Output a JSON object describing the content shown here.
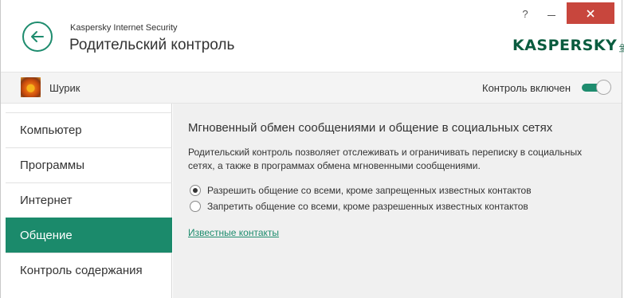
{
  "header": {
    "app_name": "Kaspersky Internet Security",
    "page_title": "Родительский контроль",
    "help": "?",
    "logo": "KASPERSKY",
    "logo_suffix": "lab"
  },
  "userbar": {
    "user_name": "Шурик",
    "control_label": "Контроль включен",
    "control_enabled": true
  },
  "sidebar": {
    "items": [
      {
        "label": "Компьютер",
        "active": false
      },
      {
        "label": "Программы",
        "active": false
      },
      {
        "label": "Интернет",
        "active": false
      },
      {
        "label": "Общение",
        "active": true
      },
      {
        "label": "Контроль содержания",
        "active": false
      }
    ]
  },
  "content": {
    "title": "Мгновенный обмен сообщениями и общение в социальных сетях",
    "description": "Родительский контроль позволяет отслеживать и ограничивать переписку в социальных сетях, а также в программах обмена мгновенными сообщениями.",
    "options": [
      {
        "label": "Разрешить общение со всеми, кроме запрещенных известных контактов",
        "selected": true
      },
      {
        "label": "Запретить общение со всеми, кроме разрешенных известных контактов",
        "selected": false
      }
    ],
    "link": "Известные контакты"
  },
  "colors": {
    "accent": "#1b8a6b",
    "close": "#c8463d",
    "content_bg": "#f0f0f0"
  }
}
